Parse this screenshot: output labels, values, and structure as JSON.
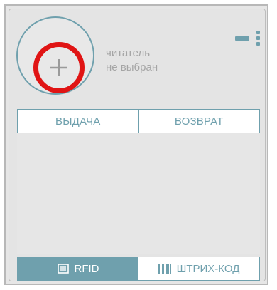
{
  "reader": {
    "status_line1": "читатель",
    "status_line2": "не выбран"
  },
  "tabs": [
    {
      "label": "ВЫДАЧА"
    },
    {
      "label": "ВОЗВРАТ"
    }
  ],
  "modes": [
    {
      "label": "RFID",
      "icon": "rfid-card-icon",
      "active": true
    },
    {
      "label": "ШТРИХ-КОД",
      "icon": "barcode-icon",
      "active": false
    }
  ],
  "colors": {
    "accent": "#6fa0ad",
    "highlight_ring": "#e01414",
    "panel_bg": "#e4e4e4",
    "muted_text": "#a5a5a5"
  }
}
